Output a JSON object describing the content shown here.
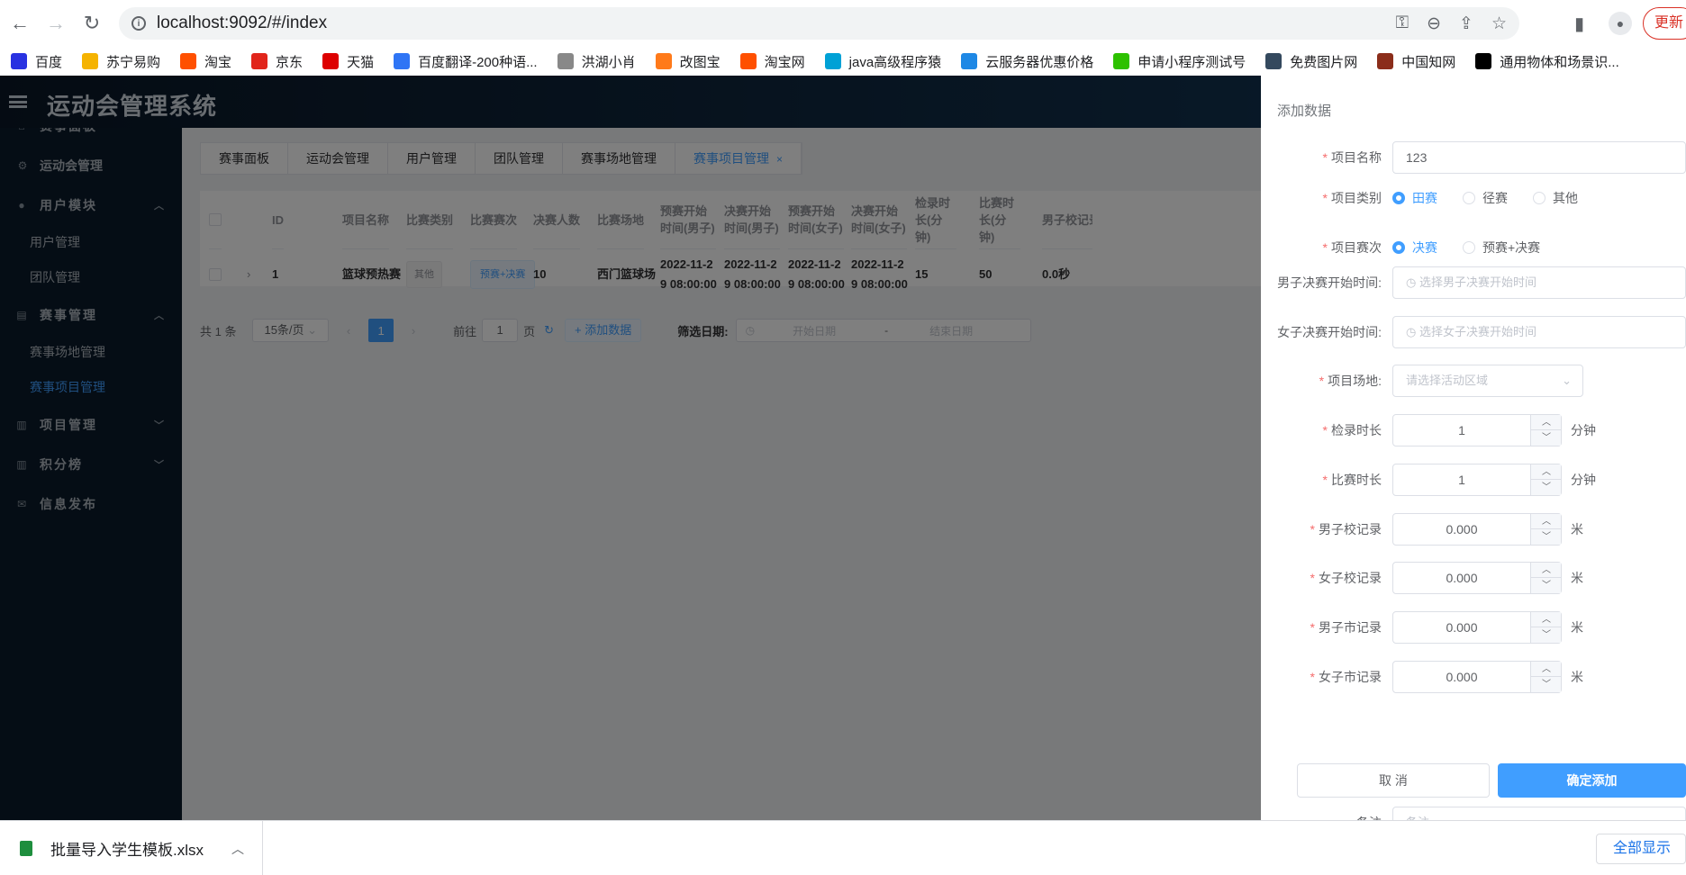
{
  "browser": {
    "url": "localhost:9092/#/index",
    "update_label": "更新"
  },
  "bookmarks": [
    {
      "label": "百度",
      "color": "#2932e1"
    },
    {
      "label": "苏宁易购",
      "color": "#f5b301"
    },
    {
      "label": "淘宝",
      "color": "#ff5000"
    },
    {
      "label": "京东",
      "color": "#e1251b"
    },
    {
      "label": "天猫",
      "color": "#d00"
    },
    {
      "label": "百度翻译-200种语...",
      "color": "#2f75f5"
    },
    {
      "label": "洪湖小肖",
      "color": "#888888"
    },
    {
      "label": "改图宝",
      "color": "#ff7a1a"
    },
    {
      "label": "淘宝网",
      "color": "#ff5000"
    },
    {
      "label": "java高级程序猿",
      "color": "#00a1d6"
    },
    {
      "label": "云服务器优惠价格",
      "color": "#1e88e5"
    },
    {
      "label": "申请小程序测试号",
      "color": "#2dc100"
    },
    {
      "label": "免费图片网",
      "color": "#34495e"
    },
    {
      "label": "中国知网",
      "color": "#8b2d1a"
    },
    {
      "label": "通用物体和场景识...",
      "color": "#000000"
    }
  ],
  "app": {
    "title": "运动会管理系统"
  },
  "menu": [
    {
      "label": "赛事面板",
      "icon": "home-icon"
    },
    {
      "label": "运动会管理",
      "icon": "settings-icon"
    },
    {
      "label": "用户模块",
      "icon": "user-icon"
    },
    {
      "label": "用户管理"
    },
    {
      "label": "团队管理"
    },
    {
      "label": "赛事管理",
      "icon": "list-icon"
    },
    {
      "label": "赛事场地管理"
    },
    {
      "label": "赛事项目管理"
    },
    {
      "label": "项目管理",
      "icon": "doc-icon"
    },
    {
      "label": "积分榜",
      "icon": "doc-icon"
    },
    {
      "label": "信息发布",
      "icon": "mail-icon"
    }
  ],
  "tabs": [
    "赛事面板",
    "运动会管理",
    "用户管理",
    "团队管理",
    "赛事场地管理",
    "赛事项目管理"
  ],
  "table": {
    "headers": [
      "ID",
      "项目名称",
      "比赛类别",
      "比赛赛次",
      "决赛人数",
      "比赛场地",
      "预赛开始时间(男子)",
      "决赛开始时间(男子)",
      "预赛开始时间(女子)",
      "决赛开始时间(女子)",
      "检录时长(分钟)",
      "比赛时长(分钟)",
      "男子校记录"
    ],
    "rows": [
      [
        "1",
        "篮球预热赛",
        "其他",
        "预赛+决赛",
        "10",
        "西门篮球场",
        "2022-11-2 9 08:00:00",
        "2022-11-2 9 08:00:00",
        "2022-11-2 9 08:00:00",
        "2022-11-2 9 08:00:00",
        "15",
        "50",
        "0.0秒"
      ]
    ]
  },
  "pager": {
    "total": "共 1 条",
    "size": "15条/页",
    "current": "1",
    "goto_prefix": "前往",
    "goto_value": "1",
    "goto_suffix": "页",
    "add_label": "+ 添加数据",
    "filter_label": "筛选日期:",
    "start_ph": "开始日期",
    "sep": "-",
    "end_ph": "结束日期"
  },
  "drawer": {
    "title": "添加数据",
    "name_label": "项目名称",
    "name_value": "123",
    "cat_label": "项目类别",
    "cat_options": [
      "田赛",
      "径赛",
      "其他"
    ],
    "round_label": "项目赛次",
    "round_options": [
      "决赛",
      "预赛+决赛"
    ],
    "men_time_label": "男子决赛开始时间:",
    "men_time_ph": "选择男子决赛开始时间",
    "women_time_label": "女子决赛开始时间:",
    "women_time_ph": "选择女子决赛开始时间",
    "venue_label": "项目场地:",
    "venue_ph": "请选择活动区域",
    "checkin_label": "检录时长",
    "checkin_value": "1",
    "checkin_unit": "分钟",
    "duration_label": "比赛时长",
    "duration_value": "1",
    "duration_unit": "分钟",
    "men_school_label": "男子校记录",
    "men_school_value": "0.000",
    "men_school_unit": "米",
    "women_school_label": "女子校记录",
    "women_school_value": "0.000",
    "women_school_unit": "米",
    "men_city_label": "男子市记录",
    "men_city_value": "0.000",
    "men_city_unit": "米",
    "women_city_label": "女子市记录",
    "women_city_value": "0.000",
    "women_city_unit": "米",
    "note_label": "备注",
    "note_ph": "备注",
    "cancel": "取 消",
    "confirm": "确定添加"
  },
  "downloads": {
    "file": "批量导入学生模板.xlsx",
    "show_all": "全部显示"
  }
}
